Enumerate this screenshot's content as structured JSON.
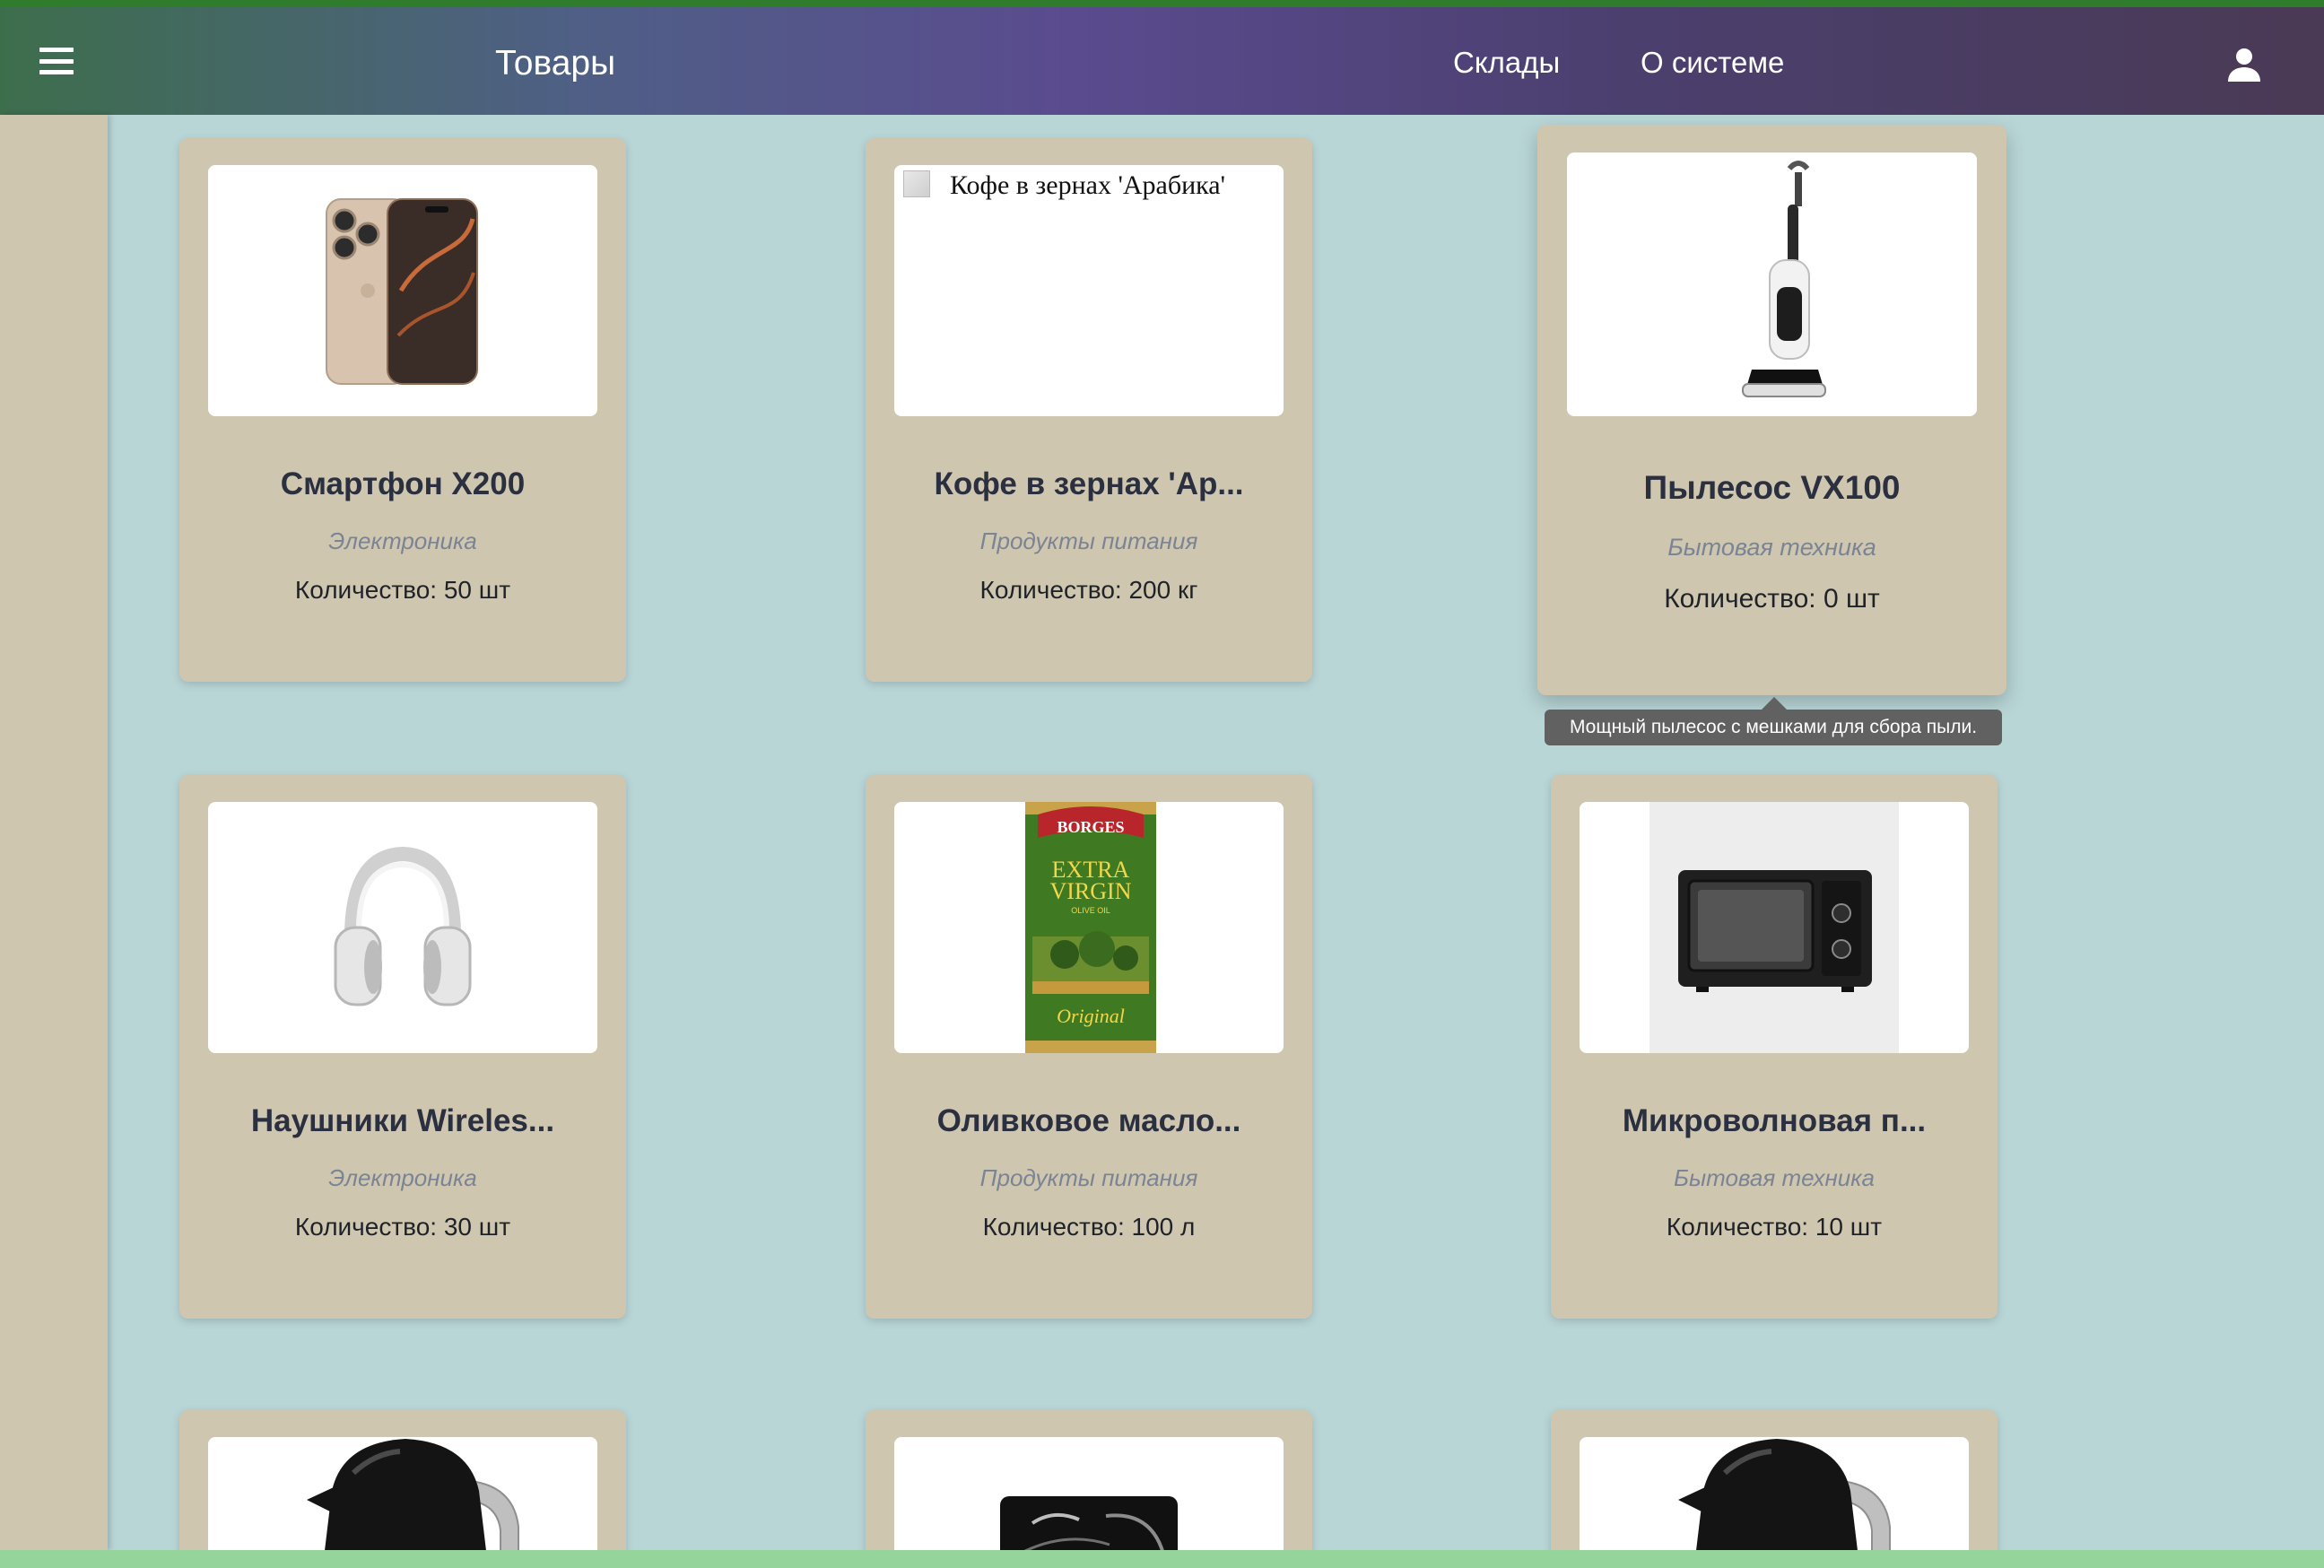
{
  "appbar": {
    "title": "Товары",
    "nav": [
      "Склады",
      "О системе"
    ],
    "menu_icon": "menu-icon",
    "account_icon": "account-icon",
    "gradient": [
      "#3d6e4c",
      "#5a4b8f",
      "#4a3a55"
    ]
  },
  "colors": {
    "page_background": "#b9d6d7",
    "card_background": "#cfc6b0",
    "tooltip_background": "#616161",
    "category_text": "#7a8494"
  },
  "products": [
    {
      "name": "Смартфон X200",
      "category": "Электроника",
      "quantity": "Количество: 50 шт",
      "image": "smartphone"
    },
    {
      "name": "Кофе в зернах 'Ар...",
      "category": "Продукты питания",
      "quantity": "Количество: 200 кг",
      "image": "broken",
      "image_alt": "Кофе в зернах 'Арабика'"
    },
    {
      "name": "Пылесос VX100",
      "category": "Бытовая техника",
      "quantity": "Количество: 0 шт",
      "image": "vacuum",
      "tooltip": "Мощный пылесос с мешками для сбора пыли."
    },
    {
      "name": "Наушники Wireles...",
      "category": "Электроника",
      "quantity": "Количество: 30 шт",
      "image": "headphones"
    },
    {
      "name": "Оливковое масло...",
      "category": "Продукты питания",
      "quantity": "Количество: 100 л",
      "image": "olive-oil",
      "label_lines": [
        "BORGES",
        "EXTRA",
        "VIRGIN",
        "OLIVE OIL",
        "Original"
      ]
    },
    {
      "name": "Микроволновая п...",
      "category": "Бытовая техника",
      "quantity": "Количество: 10 шт",
      "image": "microwave"
    },
    {
      "image": "kettle"
    },
    {
      "image": "dark-appliance"
    },
    {
      "image": "kettle"
    }
  ]
}
